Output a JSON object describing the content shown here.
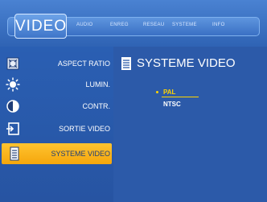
{
  "header": {
    "active_tab": "VIDEO",
    "tabs": [
      "AUDIO",
      "ENREG",
      "RESEAU",
      "SYSTEME",
      "INFO"
    ]
  },
  "sidebar": {
    "items": [
      {
        "label": "ASPECT RATIO",
        "icon": "aspect-ratio-icon"
      },
      {
        "label": "LUMIN.",
        "icon": "brightness-icon"
      },
      {
        "label": "CONTR.",
        "icon": "contrast-icon"
      },
      {
        "label": "SORTIE VIDEO",
        "icon": "video-output-icon"
      },
      {
        "label": "SYSTEME VIDEO",
        "icon": "video-system-icon",
        "selected": true
      }
    ]
  },
  "panel": {
    "title": "SYSTEME VIDEO",
    "options": [
      "PAL",
      "NTSC"
    ],
    "selected_option": "PAL"
  },
  "colors": {
    "background": "#2b5aa8",
    "highlight": "#f5a60c",
    "selected_text": "#ffd400"
  }
}
